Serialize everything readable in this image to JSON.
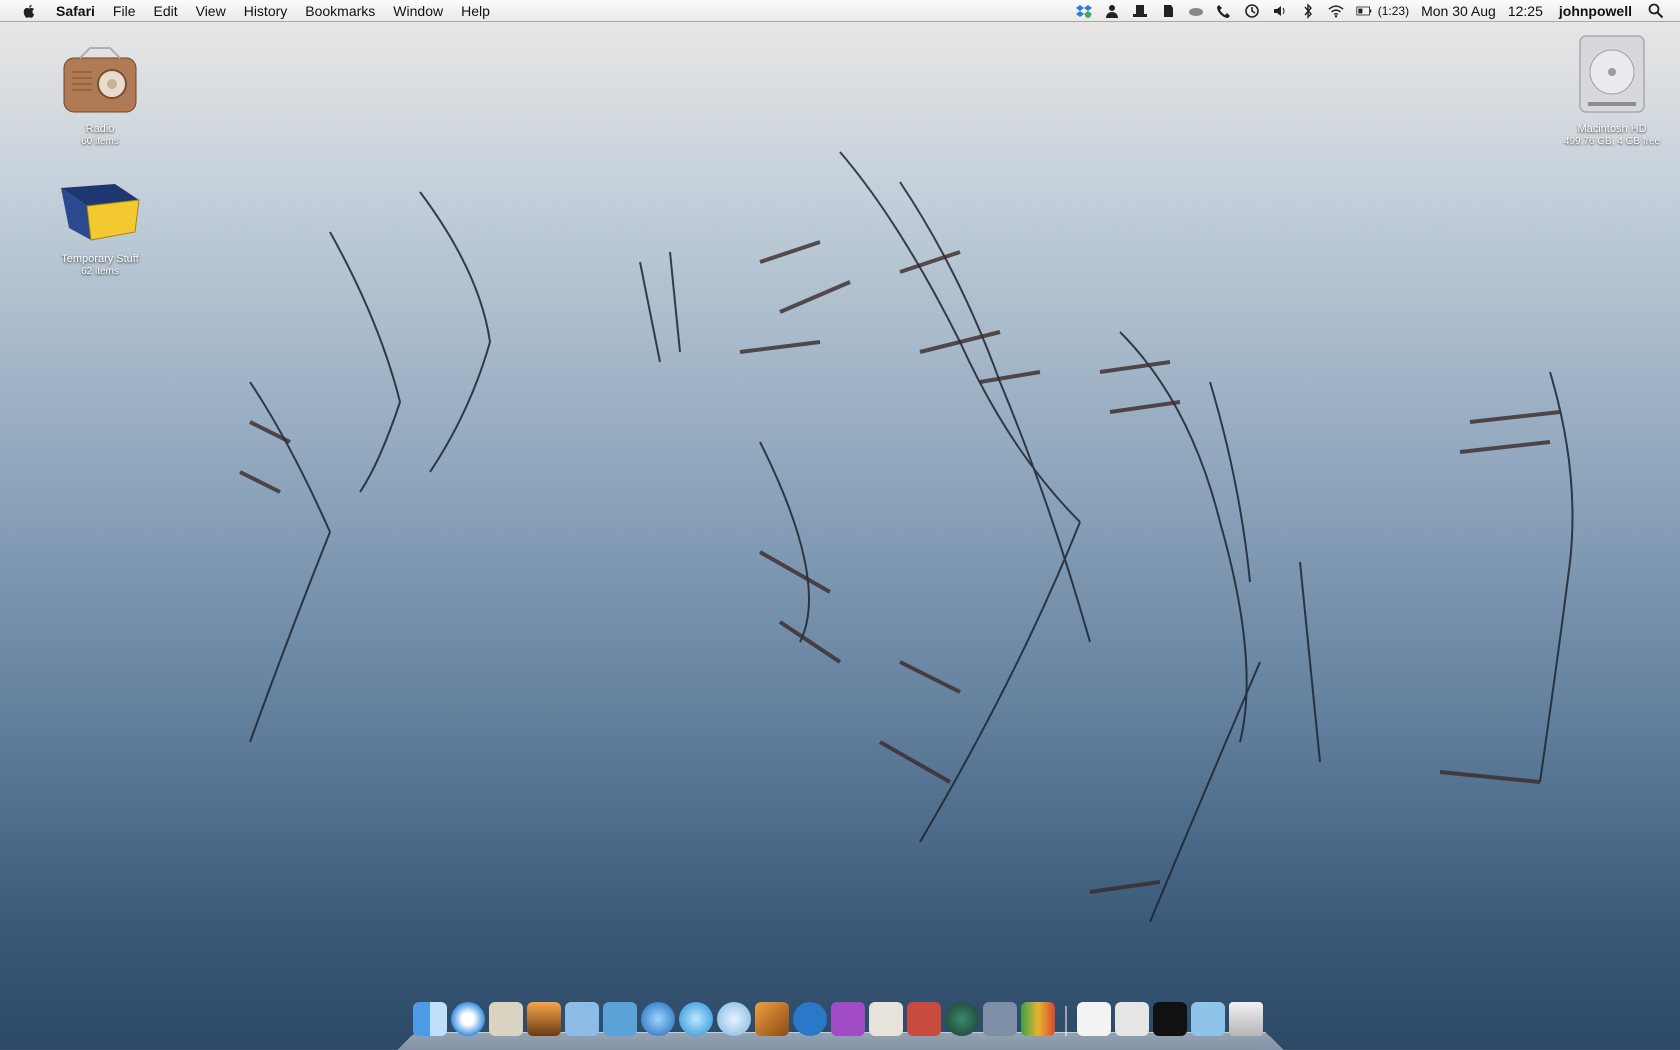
{
  "menubar": {
    "app_name": "Safari",
    "items": [
      "File",
      "Edit",
      "View",
      "History",
      "Bookmarks",
      "Window",
      "Help"
    ],
    "battery_time": "(1:23)",
    "date": "Mon 30 Aug",
    "time": "12:25",
    "user": "johnpowell",
    "tray_icons": [
      "dropbox-icon",
      "user-icon",
      "hat-icon",
      "evernote-icon",
      "cloud-icon",
      "phone-icon",
      "time-machine-icon",
      "volume-icon",
      "bluetooth-icon",
      "wifi-icon",
      "battery-icon"
    ]
  },
  "desktop": {
    "icons": [
      {
        "name": "Radio",
        "sub": "60 items"
      },
      {
        "name": "Temporary Stuff",
        "sub": "62 items"
      },
      {
        "name": "Macintosh HD",
        "sub": "499.76 GB, 4 GB free"
      }
    ]
  },
  "dock": {
    "apps": [
      "finder-icon",
      "safari-icon",
      "mail-icon",
      "iphoto-icon",
      "ichat-icon",
      "preview-icon",
      "spotlight-q-icon",
      "quicktime-icon",
      "itunes-icon",
      "garageband-icon",
      "skype-icon",
      "folder-purple-icon",
      "dictionary-icon",
      "address-book-icon",
      "time-machine-icon",
      "system-preferences-icon",
      "numbers-icon"
    ],
    "docs": [
      "xml-document-icon",
      "documents-stack-icon",
      "terminal-icon",
      "downloads-folder-icon",
      "trash-icon"
    ]
  }
}
